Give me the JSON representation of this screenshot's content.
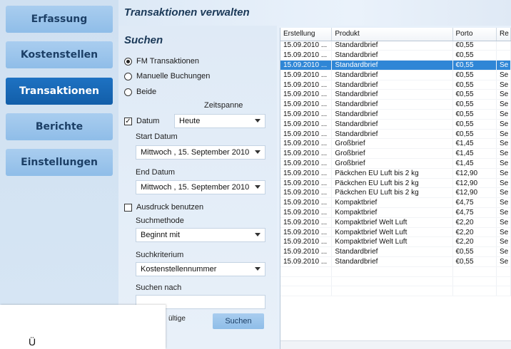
{
  "nav": {
    "items": [
      {
        "label": "Erfassung",
        "active": false
      },
      {
        "label": "Kostenstellen",
        "active": false
      },
      {
        "label": "Transaktionen",
        "active": true
      },
      {
        "label": "Berichte",
        "active": false
      },
      {
        "label": "Einstellungen",
        "active": false
      }
    ]
  },
  "page_title": "Transaktionen verwalten",
  "search": {
    "title": "Suchen",
    "radio_fm": "FM Transaktionen",
    "radio_manual": "Manuelle Buchungen",
    "radio_both": "Beide",
    "zeitspanne_label": "Zeitspanne",
    "datum_label": "Datum",
    "datum_value": "Heute",
    "start_label": "Start Datum",
    "start_value": "Mittwoch  , 15. September 2010",
    "end_label": "End Datum",
    "end_value": "Mittwoch  , 15. September 2010",
    "ausdruck_label": "Ausdruck benutzen",
    "suchmethode_label": "Suchmethode",
    "suchmethode_value": "Beginnt mit",
    "suchkriterium_label": "Suchkriterium",
    "suchkriterium_value": "Kostenstellennummer",
    "suchen_nach_label": "Suchen nach",
    "suchen_nach_value": "",
    "partial_label": "ültige",
    "button_label": "Suchen"
  },
  "overlay": {
    "text": "Ü"
  },
  "grid": {
    "columns": [
      "Erstellung",
      "Produkt",
      "Porto",
      "Re"
    ],
    "selected_row": 2,
    "rows": [
      [
        "15.09.2010 ...",
        "Standardbrief",
        "€0,55",
        ""
      ],
      [
        "15.09.2010 ...",
        "Standardbrief",
        "€0,55",
        ""
      ],
      [
        "15.09.2010 ...",
        "Standardbrief",
        "€0,55",
        "Se"
      ],
      [
        "15.09.2010 ...",
        "Standardbrief",
        "€0,55",
        "Se"
      ],
      [
        "15.09.2010 ...",
        "Standardbrief",
        "€0,55",
        "Se"
      ],
      [
        "15.09.2010 ...",
        "Standardbrief",
        "€0,55",
        "Se"
      ],
      [
        "15.09.2010 ...",
        "Standardbrief",
        "€0,55",
        "Se"
      ],
      [
        "15.09.2010 ...",
        "Standardbrief",
        "€0,55",
        "Se"
      ],
      [
        "15.09.2010 ...",
        "Standardbrief",
        "€0,55",
        "Se"
      ],
      [
        "15.09.2010 ...",
        "Standardbrief",
        "€0,55",
        "Se"
      ],
      [
        "15.09.2010 ...",
        "Großbrief",
        "€1,45",
        "Se"
      ],
      [
        "15.09.2010 ...",
        "Großbrief",
        "€1,45",
        "Se"
      ],
      [
        "15.09.2010 ...",
        "Großbrief",
        "€1,45",
        "Se"
      ],
      [
        "15.09.2010 ...",
        "Päckchen EU Luft bis 2 kg",
        "€12,90",
        "Se"
      ],
      [
        "15.09.2010 ...",
        "Päckchen EU Luft bis 2 kg",
        "€12,90",
        "Se"
      ],
      [
        "15.09.2010 ...",
        "Päckchen EU Luft bis 2 kg",
        "€12,90",
        "Se"
      ],
      [
        "15.09.2010 ...",
        "Kompaktbrief",
        "€4,75",
        "Se"
      ],
      [
        "15.09.2010 ...",
        "Kompaktbrief",
        "€4,75",
        "Se"
      ],
      [
        "15.09.2010 ...",
        "Kompaktbrief Welt Luft",
        "€2,20",
        "Se"
      ],
      [
        "15.09.2010 ...",
        "Kompaktbrief Welt Luft",
        "€2,20",
        "Se"
      ],
      [
        "15.09.2010 ...",
        "Kompaktbrief Welt Luft",
        "€2,20",
        "Se"
      ],
      [
        "15.09.2010 ...",
        "Standardbrief",
        "€0,55",
        "Se"
      ],
      [
        "15.09.2010 ...",
        "Standardbrief",
        "€0,55",
        "Se"
      ],
      [
        "",
        "",
        "",
        ""
      ],
      [
        "",
        "",
        "",
        ""
      ],
      [
        "",
        "",
        "",
        ""
      ]
    ]
  }
}
